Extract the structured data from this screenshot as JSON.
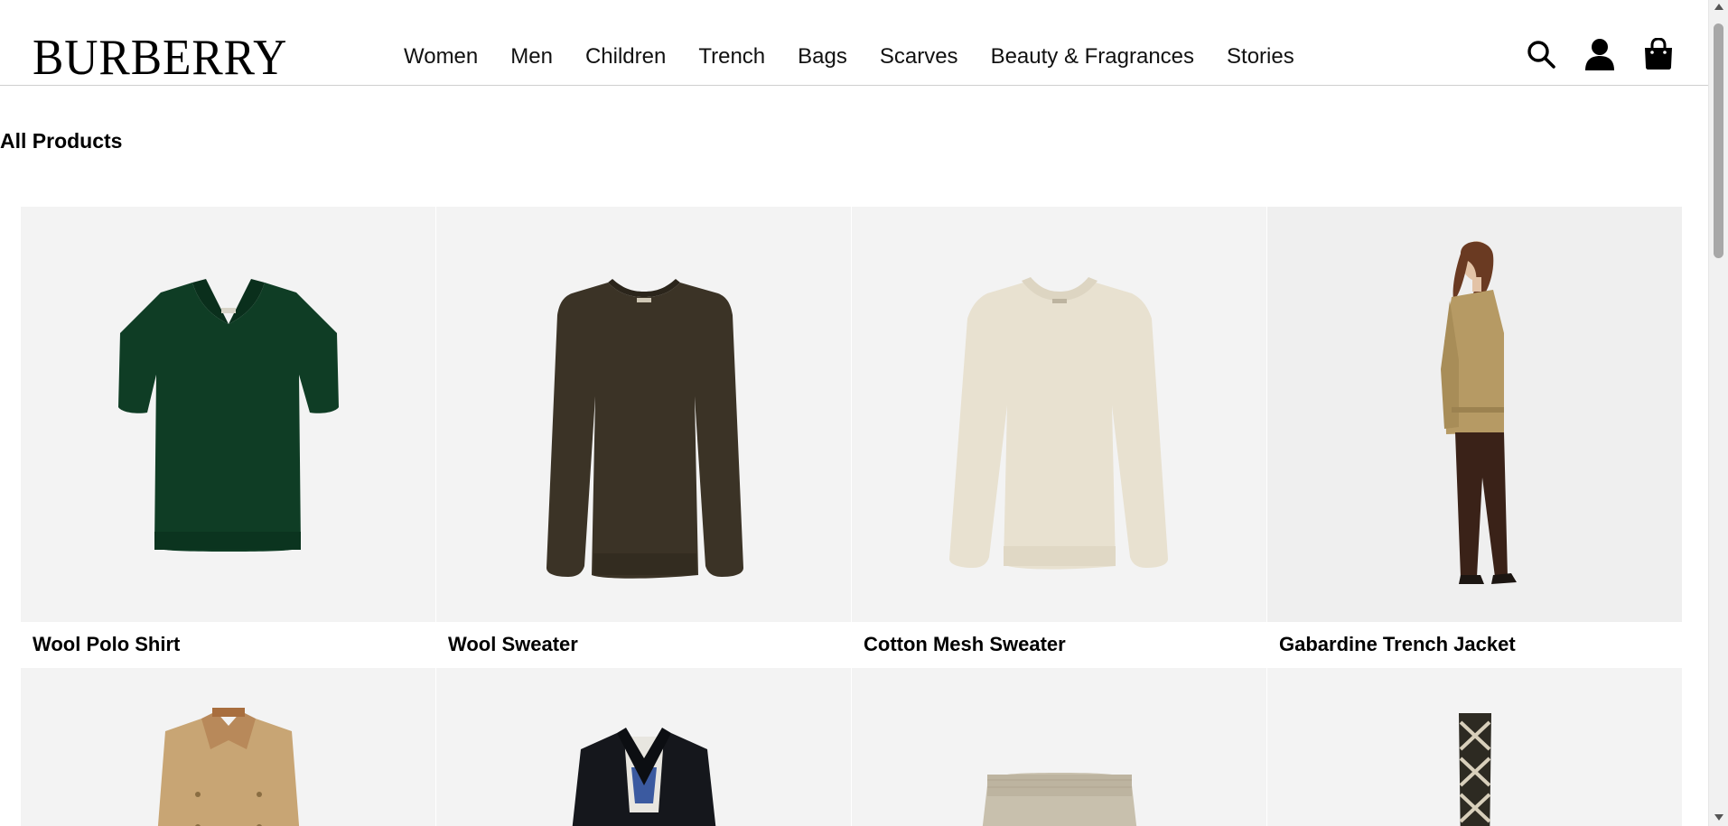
{
  "brand": {
    "name": "BURBERRY"
  },
  "nav": {
    "items": [
      "Women",
      "Men",
      "Children",
      "Trench",
      "Bags",
      "Scarves",
      "Beauty & Fragrances",
      "Stories"
    ]
  },
  "header_icons": [
    "search-icon",
    "account-icon",
    "shopping-bag-icon"
  ],
  "page": {
    "title": "All Products"
  },
  "products": [
    {
      "name": "Wool Polo Shirt",
      "color": "#0f3d25"
    },
    {
      "name": "Wool Sweater",
      "color": "#3b3326"
    },
    {
      "name": "Cotton Mesh Sweater",
      "color": "#e8e1d0"
    },
    {
      "name": "Gabardine Trench Jacket",
      "color": "#b69a64"
    }
  ],
  "products_row2": [
    {
      "color": "#c8a574"
    },
    {
      "color": "#15171c"
    },
    {
      "color": "#c8c0ad"
    },
    {
      "color": "#2d2a22"
    }
  ],
  "colors": {
    "image_bg": "#f3f3f3",
    "text": "#000000",
    "divider": "#cfcfcf"
  }
}
